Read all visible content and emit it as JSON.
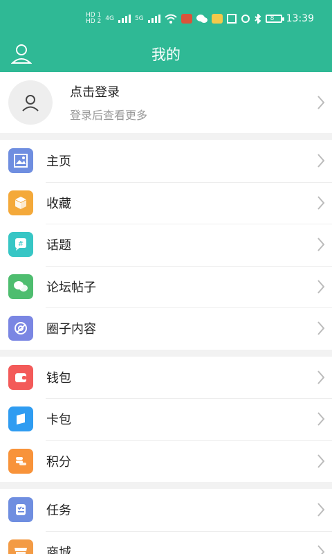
{
  "status_bar": {
    "left_small": "HD 1",
    "left_small2": "HD 2",
    "net1": "4G",
    "net2": "5G",
    "battery": "8",
    "time": "13:39"
  },
  "header": {
    "title": "我的",
    "user_icon": "user-icon"
  },
  "profile": {
    "title": "点击登录",
    "subtitle": "登录后查看更多"
  },
  "groups": [
    {
      "items": [
        {
          "label": "主页",
          "icon": "image-icon",
          "color": "#6f8ee0"
        },
        {
          "label": "收藏",
          "icon": "box-icon",
          "color": "#f4a93a"
        },
        {
          "label": "话题",
          "icon": "hashtag-icon",
          "color": "#37c6c5"
        },
        {
          "label": "论坛帖子",
          "icon": "chat-icon",
          "color": "#4ebd6f"
        },
        {
          "label": "圈子内容",
          "icon": "circle-icon",
          "color": "#7a86e3"
        }
      ]
    },
    {
      "items": [
        {
          "label": "钱包",
          "icon": "wallet-icon",
          "color": "#f35a59"
        },
        {
          "label": "卡包",
          "icon": "card-icon",
          "color": "#2f9cf1"
        },
        {
          "label": "积分",
          "icon": "coins-icon",
          "color": "#f8933a"
        }
      ]
    },
    {
      "items": [
        {
          "label": "任务",
          "icon": "task-icon",
          "color": "#6f8ee0"
        },
        {
          "label": "商城",
          "icon": "shop-icon",
          "color": "#f39b45"
        }
      ]
    }
  ],
  "colors": {
    "brand": "#2fb995"
  }
}
